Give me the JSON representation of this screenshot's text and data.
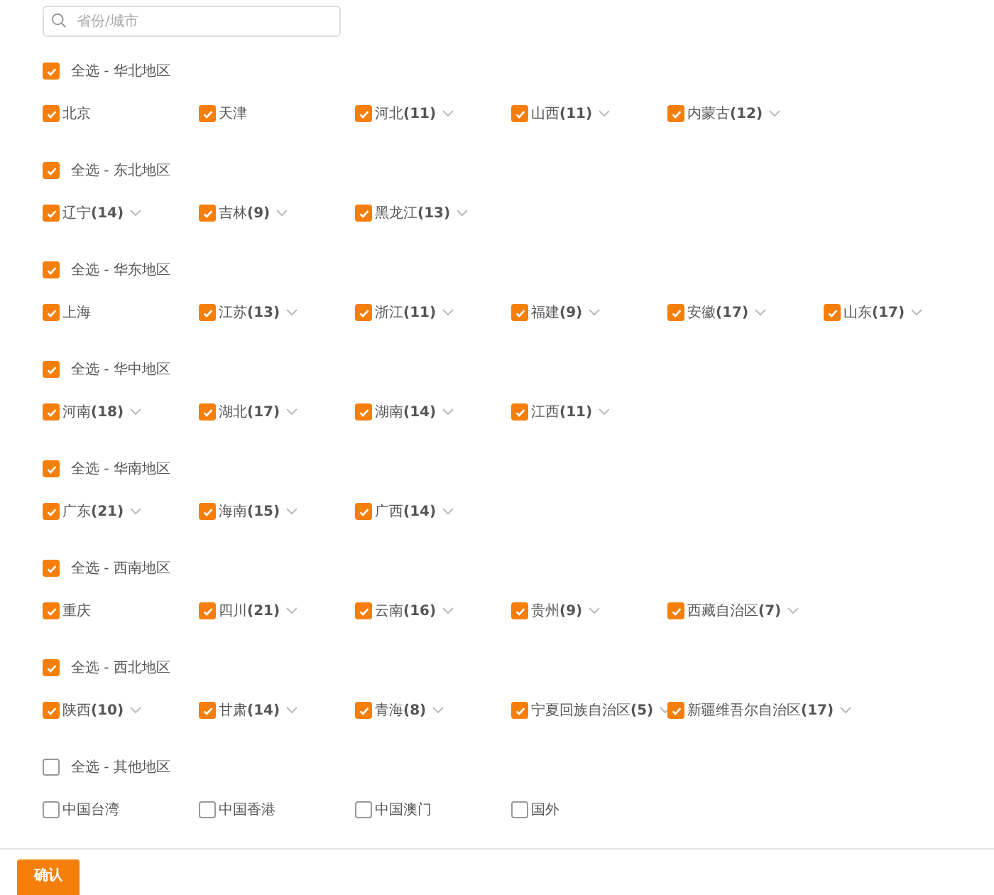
{
  "search": {
    "placeholder": "省份/城市"
  },
  "regions": [
    {
      "select_all": "全选 - 华北地区",
      "checked": true,
      "items": [
        {
          "name": "北京",
          "checked": true,
          "expandable": false
        },
        {
          "name": "天津",
          "checked": true,
          "expandable": false
        },
        {
          "name": "河北",
          "count": "(11)",
          "checked": true,
          "expandable": true
        },
        {
          "name": "山西",
          "count": "(11)",
          "checked": true,
          "expandable": true
        },
        {
          "name": "内蒙古",
          "count": "(12)",
          "checked": true,
          "expandable": true
        }
      ]
    },
    {
      "select_all": "全选 - 东北地区",
      "checked": true,
      "items": [
        {
          "name": "辽宁",
          "count": "(14)",
          "checked": true,
          "expandable": true
        },
        {
          "name": "吉林",
          "count": "(9)",
          "checked": true,
          "expandable": true
        },
        {
          "name": "黑龙江",
          "count": "(13)",
          "checked": true,
          "expandable": true
        }
      ]
    },
    {
      "select_all": "全选 - 华东地区",
      "checked": true,
      "items": [
        {
          "name": "上海",
          "checked": true,
          "expandable": false
        },
        {
          "name": "江苏",
          "count": "(13)",
          "checked": true,
          "expandable": true
        },
        {
          "name": "浙江",
          "count": "(11)",
          "checked": true,
          "expandable": true
        },
        {
          "name": "福建",
          "count": "(9)",
          "checked": true,
          "expandable": true
        },
        {
          "name": "安徽",
          "count": "(17)",
          "checked": true,
          "expandable": true
        },
        {
          "name": "山东",
          "count": "(17)",
          "checked": true,
          "expandable": true
        }
      ]
    },
    {
      "select_all": "全选 - 华中地区",
      "checked": true,
      "items": [
        {
          "name": "河南",
          "count": "(18)",
          "checked": true,
          "expandable": true
        },
        {
          "name": "湖北",
          "count": "(17)",
          "checked": true,
          "expandable": true
        },
        {
          "name": "湖南",
          "count": "(14)",
          "checked": true,
          "expandable": true
        },
        {
          "name": "江西",
          "count": "(11)",
          "checked": true,
          "expandable": true
        }
      ]
    },
    {
      "select_all": "全选 - 华南地区",
      "checked": true,
      "items": [
        {
          "name": "广东",
          "count": "(21)",
          "checked": true,
          "expandable": true
        },
        {
          "name": "海南",
          "count": "(15)",
          "checked": true,
          "expandable": true
        },
        {
          "name": "广西",
          "count": "(14)",
          "checked": true,
          "expandable": true
        }
      ]
    },
    {
      "select_all": "全选 - 西南地区",
      "checked": true,
      "items": [
        {
          "name": "重庆",
          "checked": true,
          "expandable": false
        },
        {
          "name": "四川",
          "count": "(21)",
          "checked": true,
          "expandable": true
        },
        {
          "name": "云南",
          "count": "(16)",
          "checked": true,
          "expandable": true
        },
        {
          "name": "贵州",
          "count": "(9)",
          "checked": true,
          "expandable": true
        },
        {
          "name": "西藏自治区",
          "count": "(7)",
          "checked": true,
          "expandable": true
        }
      ]
    },
    {
      "select_all": "全选 - 西北地区",
      "checked": true,
      "items": [
        {
          "name": "陕西",
          "count": "(10)",
          "checked": true,
          "expandable": true
        },
        {
          "name": "甘肃",
          "count": "(14)",
          "checked": true,
          "expandable": true
        },
        {
          "name": "青海",
          "count": "(8)",
          "checked": true,
          "expandable": true
        },
        {
          "name": "宁夏回族自治区",
          "count": "(5)",
          "checked": true,
          "expandable": true
        },
        {
          "name": "新疆维吾尔自治区",
          "count": "(17)",
          "checked": true,
          "expandable": true
        }
      ]
    },
    {
      "select_all": "全选 - 其他地区",
      "checked": false,
      "items": [
        {
          "name": "中国台湾",
          "checked": false,
          "expandable": false
        },
        {
          "name": "中国香港",
          "checked": false,
          "expandable": false
        },
        {
          "name": "中国澳门",
          "checked": false,
          "expandable": false
        },
        {
          "name": "国外",
          "checked": false,
          "expandable": false
        }
      ]
    }
  ],
  "confirm_button": "确认"
}
